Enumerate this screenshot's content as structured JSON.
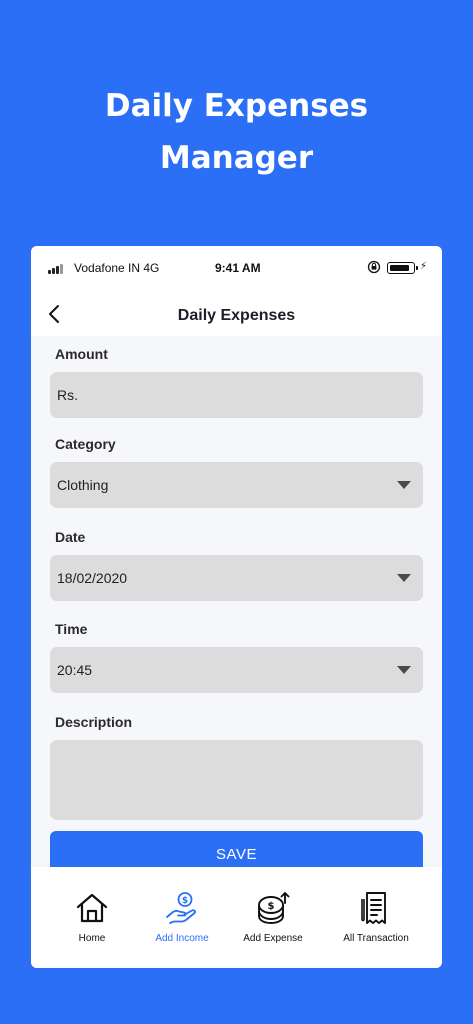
{
  "hero": {
    "line1": "Daily Expenses",
    "line2": "Manager"
  },
  "status": {
    "carrier": "Vodafone IN 4G",
    "time": "9:41 AM"
  },
  "nav": {
    "title": "Daily Expenses"
  },
  "form": {
    "amount": {
      "label": "Amount",
      "value": "Rs."
    },
    "category": {
      "label": "Category",
      "value": "Clothing"
    },
    "date": {
      "label": "Date",
      "value": "18/02/2020"
    },
    "time": {
      "label": "Time",
      "value": "20:45"
    },
    "description": {
      "label": "Description",
      "value": ""
    },
    "save_label": "SAVE"
  },
  "tabs": [
    {
      "label": "Home",
      "icon": "home-icon",
      "active": false
    },
    {
      "label": "Add Income",
      "icon": "hand-coin-icon",
      "active": true
    },
    {
      "label": "Add Expense",
      "icon": "coin-stack-icon",
      "active": false
    },
    {
      "label": "All Transaction",
      "icon": "receipt-icon",
      "active": false
    }
  ],
  "colors": {
    "primary": "#2a6ff6",
    "field": "#dcdcdc",
    "screen_bg": "#f6f7fb"
  }
}
